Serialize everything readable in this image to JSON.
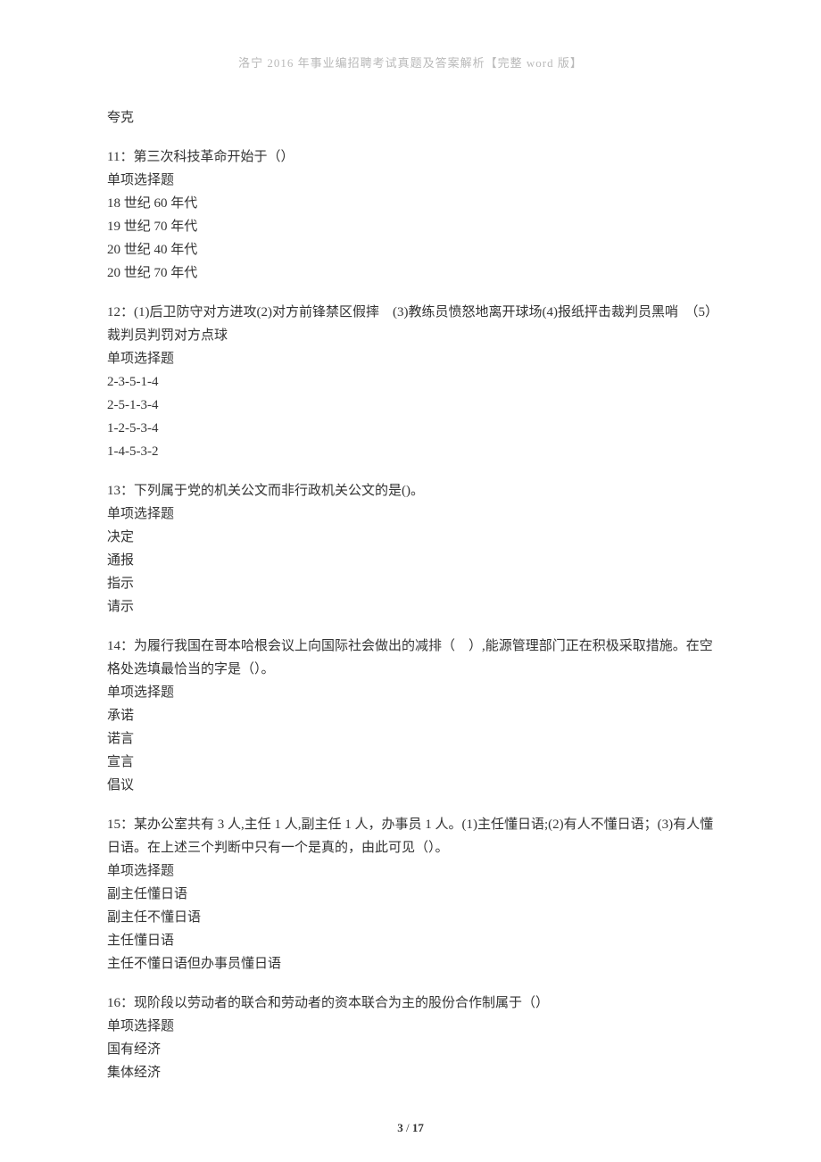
{
  "header": {
    "title": "洛宁 2016 年事业编招聘考试真题及答案解析【完整 word 版】"
  },
  "content": {
    "leading_line": "夸克",
    "questions": [
      {
        "prompt": "11：第三次科技革命开始于（）",
        "type_label": "单项选择题",
        "options": [
          "18 世纪 60 年代",
          "19 世纪 70 年代",
          "20 世纪 40 年代",
          "20 世纪 70 年代"
        ]
      },
      {
        "prompt": "12：(1)后卫防守对方进攻(2)对方前锋禁区假摔　(3)教练员愤怒地离开球场(4)报纸抨击裁判员黑哨　（5）裁判员判罚对方点球",
        "type_label": "单项选择题",
        "options": [
          "2-3-5-1-4",
          "2-5-1-3-4",
          "1-2-5-3-4",
          "1-4-5-3-2"
        ]
      },
      {
        "prompt": "13：下列属于党的机关公文而非行政机关公文的是()。",
        "type_label": "单项选择题",
        "options": [
          "决定",
          "通报",
          "指示",
          "请示"
        ]
      },
      {
        "prompt": "14：为履行我国在哥本哈根会议上向国际社会做出的减排（　）,能源管理部门正在积极采取措施。在空格处选填最恰当的字是（）。",
        "type_label": "单项选择题",
        "options": [
          "承诺",
          "诺言",
          "宣言",
          "倡议"
        ]
      },
      {
        "prompt": "15：某办公室共有 3 人,主任 1 人,副主任 1 人，办事员 1 人。(1)主任懂日语;(2)有人不懂日语；(3)有人懂日语。在上述三个判断中只有一个是真的，由此可见（）。",
        "type_label": "单项选择题",
        "options": [
          "副主任懂日语",
          "副主任不懂日语",
          "主任懂日语",
          "主任不懂日语但办事员懂日语"
        ]
      },
      {
        "prompt": "16：现阶段以劳动者的联合和劳动者的资本联合为主的股份合作制属于（）",
        "type_label": "单项选择题",
        "options": [
          "国有经济",
          "集体经济"
        ]
      }
    ]
  },
  "footer": {
    "current_page": "3",
    "separator": " / ",
    "total_pages": "17"
  }
}
